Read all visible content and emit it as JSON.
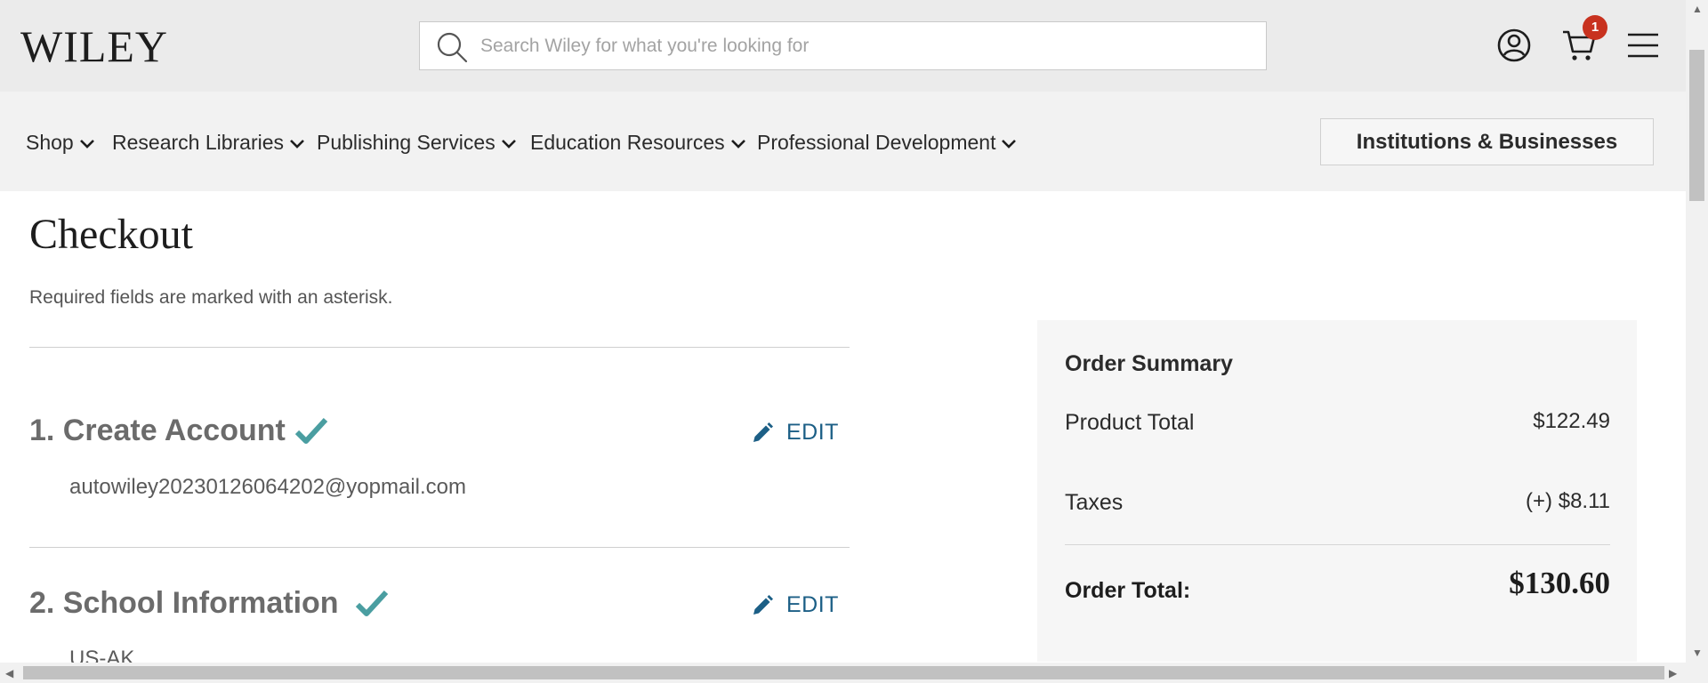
{
  "header": {
    "logo_text": "WILEY",
    "search_placeholder": "Search Wiley for what you're looking for",
    "cart_count": "1",
    "icons": [
      "search-icon",
      "account-icon",
      "cart-icon",
      "menu-icon"
    ]
  },
  "nav": {
    "items": [
      {
        "label": "Shop"
      },
      {
        "label": "Research Libraries"
      },
      {
        "label": "Publishing Services"
      },
      {
        "label": "Education Resources"
      },
      {
        "label": "Professional Development"
      }
    ],
    "cta_label": "Institutions & Businesses"
  },
  "checkout": {
    "title": "Checkout",
    "required_note": "Required fields are marked with an asterisk.",
    "steps": [
      {
        "title": "1. Create Account",
        "edit_label": "EDIT",
        "detail": "autowiley20230126064202@yopmail.com",
        "complete": true
      },
      {
        "title": "2. School Information",
        "edit_label": "EDIT",
        "detail": "US-AK",
        "complete": true
      }
    ]
  },
  "summary": {
    "title": "Order Summary",
    "rows": [
      {
        "label": "Product Total",
        "value": "$122.49"
      },
      {
        "label": "Taxes",
        "value": "(+) $8.11"
      }
    ],
    "total_label": "Order Total:",
    "total_value": "$130.60"
  },
  "colors": {
    "header_bg": "#ebebeb",
    "nav_bg": "#f2f2f2",
    "check": "#4a9ea1",
    "edit": "#1c5f86",
    "badge": "#c8321f"
  }
}
